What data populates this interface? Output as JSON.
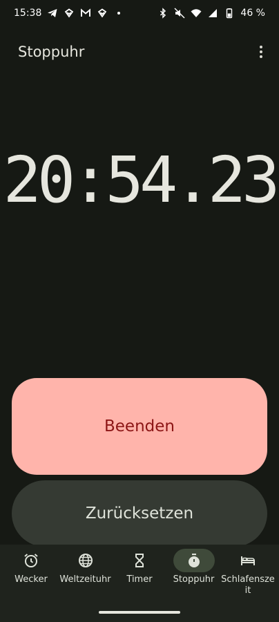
{
  "status_bar": {
    "time": "15:38",
    "left_icons": [
      "telegram-icon",
      "heart-app-icon",
      "gmail-icon",
      "heart-app-icon"
    ],
    "right_icons": [
      "bluetooth-icon",
      "mute-icon",
      "wifi-icon",
      "signal-icon",
      "battery-icon"
    ],
    "battery": "46 %"
  },
  "app_bar": {
    "title": "Stoppuhr",
    "menu_icon": "more-vert-icon"
  },
  "stopwatch": {
    "elapsed": "20:54.23"
  },
  "buttons": {
    "stop_label": "Beenden",
    "reset_label": "Zurücksetzen"
  },
  "bottom_nav": {
    "items": [
      {
        "label": "Wecker",
        "icon": "alarm-icon",
        "active": false
      },
      {
        "label": "Weltzeituhr",
        "icon": "globe-icon",
        "active": false
      },
      {
        "label": "Timer",
        "icon": "hourglass-icon",
        "active": false
      },
      {
        "label": "Stoppuhr",
        "icon": "stopwatch-icon",
        "active": true
      },
      {
        "label": "Schlafenszeit",
        "icon": "bed-icon",
        "active": false
      }
    ]
  },
  "colors": {
    "background": "#161914",
    "stop_button": "#ffb4ab",
    "stop_text": "#8c1515",
    "reset_button": "#353a33",
    "nav_background": "#1f231d",
    "active_pill": "#3f4a3a"
  }
}
